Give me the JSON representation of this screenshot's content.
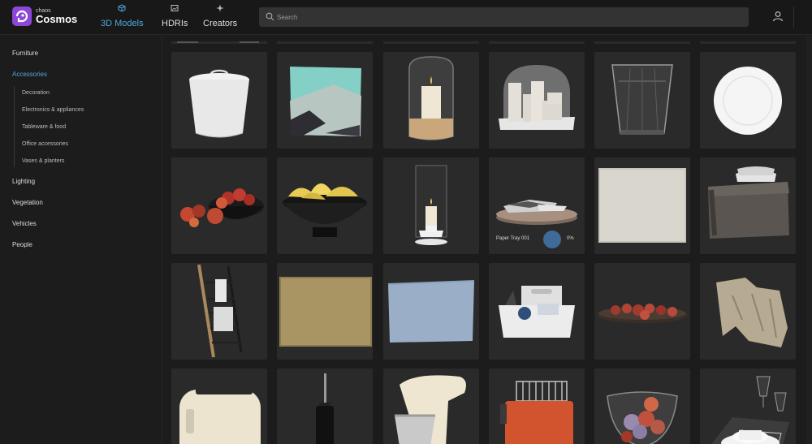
{
  "app": {
    "brand_small": "chaos",
    "brand": "Cosmos"
  },
  "nav": [
    {
      "label": "3D Models",
      "icon": "cube-icon",
      "active": true
    },
    {
      "label": "HDRIs",
      "icon": "image-icon",
      "active": false
    },
    {
      "label": "Creators",
      "icon": "sparkle-icon",
      "active": false
    }
  ],
  "search": {
    "placeholder": "Search"
  },
  "sidebar": {
    "categories": [
      {
        "label": "Furniture",
        "active": false
      },
      {
        "label": "Accessories",
        "active": true
      },
      {
        "label": "Lighting",
        "active": false
      },
      {
        "label": "Vegetation",
        "active": false
      },
      {
        "label": "Vehicles",
        "active": false
      },
      {
        "label": "People",
        "active": false
      }
    ],
    "subcategories": [
      {
        "label": "Decoration"
      },
      {
        "label": "Electronics & appliances"
      },
      {
        "label": "Tableware & food"
      },
      {
        "label": "Office accessories"
      },
      {
        "label": "Vases & planters"
      }
    ]
  },
  "colors": {
    "accent": "#4ea8de",
    "brand": "#8d47d8",
    "card_bg": "#2a2a2a",
    "page_bg": "#1c1c1c"
  },
  "grid": {
    "hover_card": {
      "title": "Paper Tray 001",
      "progress": "0%"
    },
    "items": [
      "lidded-basket",
      "throw-pillow",
      "glass-candle-holder",
      "candle-set",
      "drinking-glass",
      "white-plate",
      "apples-bowl",
      "banana-bowl",
      "hurricane-candle",
      "paper-tray",
      "linen-towel",
      "storage-basket",
      "towel-ladder",
      "jute-rug",
      "blue-rug",
      "desk-organizer",
      "fruit-tray",
      "draped-blanket",
      "toaster",
      "toilet-brush",
      "stand-mixer",
      "retro-toaster",
      "glass-fruit-bowl",
      "table-setting"
    ]
  }
}
